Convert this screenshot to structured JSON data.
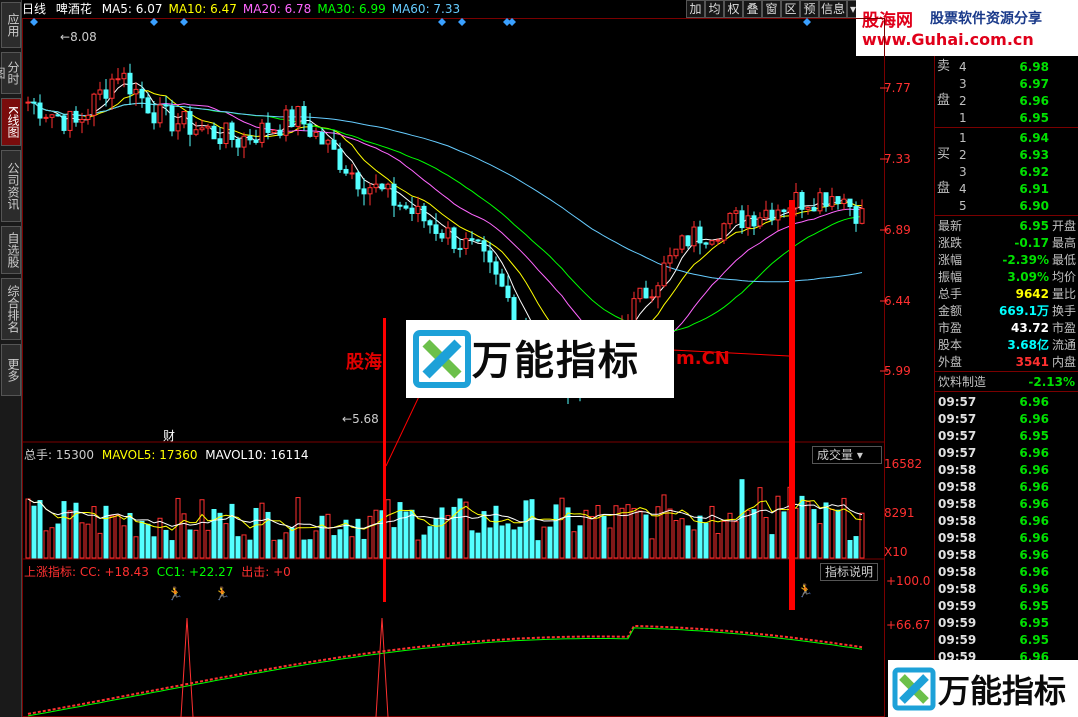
{
  "side_tabs": [
    "应用",
    "分时图",
    "K线图",
    "公司资讯",
    "自选股",
    "综合排名",
    "更多"
  ],
  "active_tab": 2,
  "kline": {
    "period": "日线",
    "stock": "啤酒花",
    "ma": [
      {
        "label": "MA5: 6.07",
        "color": "#ffffff"
      },
      {
        "label": "MA10: 6.47",
        "color": "#ffff00"
      },
      {
        "label": "MA20: 6.78",
        "color": "#ff66ff"
      },
      {
        "label": "MA30: 6.99",
        "color": "#00ff00"
      },
      {
        "label": "MA60: 7.33",
        "color": "#66ccff"
      }
    ],
    "price_ticks": [
      "7.77",
      "7.33",
      "6.89",
      "6.44",
      "5.99"
    ],
    "high_label": "8.08",
    "low_label": "5.68",
    "cai_marker": "财"
  },
  "toolbar": [
    "加",
    "均",
    "权",
    "叠",
    "窗",
    "区",
    "预",
    "信息"
  ],
  "volume": {
    "header": "总手: 15300",
    "mavol5": "MAVOL5: 17360",
    "mavol10": "MAVOL10: 16114",
    "dropdown": "成交量",
    "ticks": [
      "16582",
      "8291"
    ],
    "unit": "X10"
  },
  "indicator": {
    "name": "上涨指标:",
    "cc": "CC: +18.43",
    "cc1": "CC1: +22.27",
    "out": "出击: +0",
    "button": "指标说明",
    "ticks": [
      "+100.0",
      "+66.67"
    ]
  },
  "brand": {
    "name": "股海网",
    "slogan": "股票软件资源分享",
    "url": "www.Guhai.com.cn"
  },
  "watermark": {
    "title": "万能指标",
    "overlay_left": "股海",
    "overlay_right": "m.CN"
  },
  "quote": {
    "sell": [
      {
        "side": "卖",
        "lvl": "4",
        "price": "6.98"
      },
      {
        "side": "",
        "lvl": "3",
        "price": "6.97"
      },
      {
        "side": "盘",
        "lvl": "2",
        "price": "6.96"
      },
      {
        "side": "",
        "lvl": "1",
        "price": "6.95"
      }
    ],
    "buy": [
      {
        "side": "",
        "lvl": "1",
        "price": "6.94"
      },
      {
        "side": "买",
        "lvl": "2",
        "price": "6.93"
      },
      {
        "side": "",
        "lvl": "3",
        "price": "6.92"
      },
      {
        "side": "盘",
        "lvl": "4",
        "price": "6.91"
      },
      {
        "side": "",
        "lvl": "5",
        "price": "6.90"
      }
    ],
    "stats": [
      {
        "label": "最新",
        "value": "6.95",
        "color": "#00e000",
        "label2": "开盘"
      },
      {
        "label": "涨跌",
        "value": "-0.17",
        "color": "#00e000",
        "label2": "最高"
      },
      {
        "label": "涨幅",
        "value": "-2.39%",
        "color": "#00e000",
        "label2": "最低"
      },
      {
        "label": "振幅",
        "value": "3.09%",
        "color": "#00e000",
        "label2": "均价"
      },
      {
        "label": "总手",
        "value": "9642",
        "color": "#ffff00",
        "label2": "量比"
      },
      {
        "label": "金额",
        "value": "669.1万",
        "color": "#00ffff",
        "label2": "换手"
      },
      {
        "label": "市盈",
        "value": "43.72",
        "color": "#ffffff",
        "label2": "市盈"
      },
      {
        "label": "股本",
        "value": "3.68亿",
        "color": "#00ffff",
        "label2": "流通"
      },
      {
        "label": "外盘",
        "value": "3541",
        "color": "#ff3030",
        "label2": "内盘"
      }
    ],
    "sector_name": "饮料制造",
    "sector_change": "-2.13%",
    "ticks": [
      {
        "time": "09:57",
        "price": "6.96"
      },
      {
        "time": "09:57",
        "price": "6.96"
      },
      {
        "time": "09:57",
        "price": "6.95"
      },
      {
        "time": "09:57",
        "price": "6.96"
      },
      {
        "time": "09:58",
        "price": "6.96"
      },
      {
        "time": "09:58",
        "price": "6.96"
      },
      {
        "time": "09:58",
        "price": "6.96"
      },
      {
        "time": "09:58",
        "price": "6.96"
      },
      {
        "time": "09:58",
        "price": "6.96"
      },
      {
        "time": "09:58",
        "price": "6.96"
      },
      {
        "time": "09:58",
        "price": "6.96"
      },
      {
        "time": "09:58",
        "price": "6.96"
      },
      {
        "time": "09:59",
        "price": "6.95"
      },
      {
        "time": "09:59",
        "price": "6.95"
      },
      {
        "time": "09:59",
        "price": "6.95"
      },
      {
        "time": "09:59",
        "price": "6.96"
      }
    ]
  }
}
